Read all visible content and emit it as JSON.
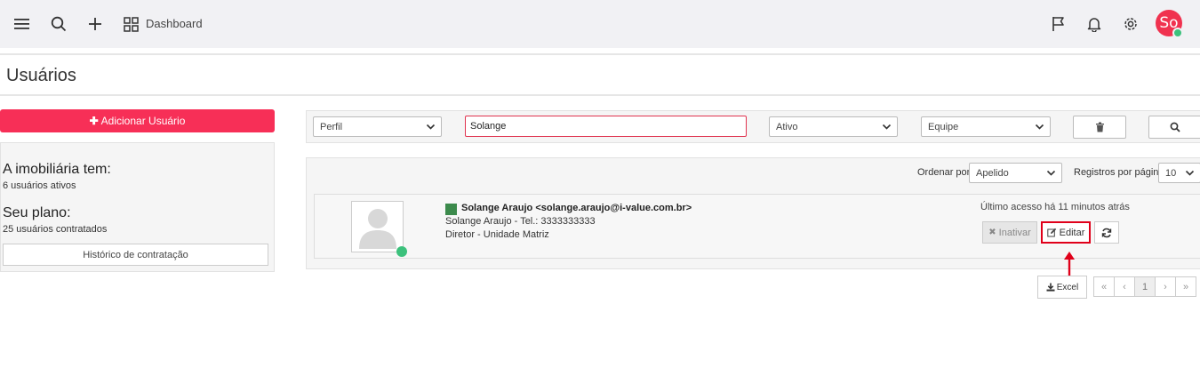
{
  "header": {
    "dashboard_label": "Dashboard",
    "avatar_initials": "So",
    "icons": [
      "menu-icon",
      "search-icon",
      "plus-icon",
      "grid-icon",
      "flag-icon",
      "bell-icon",
      "gear-icon"
    ]
  },
  "page": {
    "title": "Usuários"
  },
  "sidebar": {
    "add_user_label": "Adicionar Usuário",
    "agency_heading": "A imobiliária tem:",
    "agency_count": "6 usuários ativos",
    "plan_heading": "Seu plano:",
    "plan_count": "25 usuários contratados",
    "history_label": "Histórico de contratação"
  },
  "filters": {
    "perfil": "Perfil",
    "search_value": "Solange",
    "status": "Ativo",
    "equipe": "Equipe"
  },
  "results": {
    "order_label": "Ordenar por",
    "order_value": "Apelido",
    "per_page_label": "Registros por página",
    "per_page_value": "10"
  },
  "user": {
    "name_email": "Solange Araujo <solange.araujo@i-value.com.br>",
    "phone_line": "Solange Araujo - Tel.: 3333333333",
    "role_line": "Diretor  - Unidade Matriz",
    "last_access": "Último acesso há 11 minutos atrás",
    "inativar_label": "Inativar",
    "editar_label": "Editar"
  },
  "footer": {
    "excel_label": "Excel",
    "pages": [
      "«",
      "‹",
      "1",
      "›",
      "»"
    ],
    "current_page": "1"
  },
  "colors": {
    "accent": "#f72f57",
    "highlight": "#e0001a",
    "online": "#3cc17c"
  }
}
